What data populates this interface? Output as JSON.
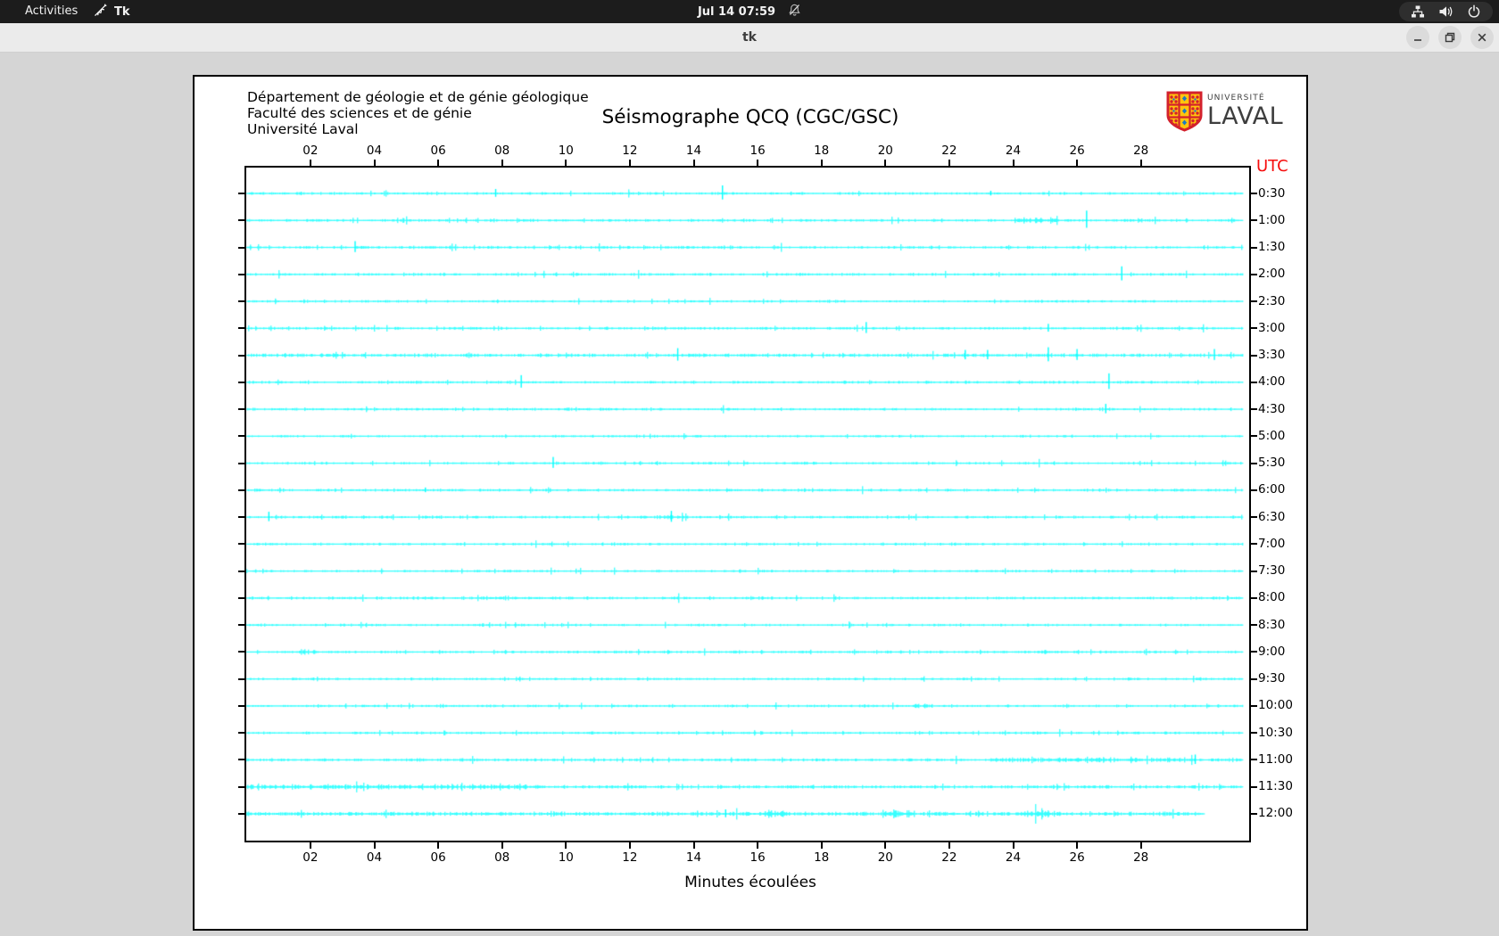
{
  "top_bar": {
    "activities": "Activities",
    "app_name": "Tk",
    "clock": "Jul 14 07:59",
    "bell_icon": "bell-muted",
    "status_icons": [
      "network",
      "volume",
      "power"
    ]
  },
  "window": {
    "title": "tk",
    "controls": [
      "minimize",
      "maximize",
      "close"
    ]
  },
  "document": {
    "org_lines": [
      "Département de géologie et de génie géologique",
      "Faculté des sciences et de génie",
      "Université Laval"
    ],
    "title": "Séismographe QCQ (CGC/GSC)",
    "logo": {
      "top": "UNIVERSITÉ",
      "bottom": "LAVAL"
    },
    "utc": "UTC",
    "utc_color": "#f60d0d",
    "xlabel": "Minutes écoulées"
  },
  "chart_data": {
    "type": "line",
    "title": "Séismographe QCQ (CGC/GSC)",
    "xlabel": "Minutes écoulées",
    "right_axis_title": "UTC",
    "x_range": [
      0,
      31.4
    ],
    "row_duration_min": 30,
    "x_axis_minutes": [
      2,
      4,
      6,
      8,
      10,
      12,
      14,
      16,
      18,
      20,
      22,
      24,
      26,
      28
    ],
    "x_tick_labels": [
      "02",
      "04",
      "06",
      "08",
      "10",
      "12",
      "14",
      "16",
      "18",
      "20",
      "22",
      "24",
      "26",
      "28"
    ],
    "trace_color": "#00ffff",
    "axis_color": "#000000",
    "background": "#ffffff",
    "rows": [
      {
        "label": "0:30",
        "base": 1.0,
        "spikes": [
          [
            7.8,
            5
          ],
          [
            14.9,
            9
          ],
          [
            23.3,
            3
          ]
        ],
        "bursts": []
      },
      {
        "label": "1:00",
        "base": 1.0,
        "spikes": [
          [
            26.3,
            11
          ]
        ],
        "bursts": [
          [
            24.0,
            25.4,
            2.4
          ]
        ]
      },
      {
        "label": "1:30",
        "base": 1.0,
        "spikes": [
          [
            3.4,
            7
          ]
        ],
        "bursts": []
      },
      {
        "label": "2:00",
        "base": 0.95,
        "spikes": [
          [
            27.4,
            9
          ]
        ],
        "bursts": []
      },
      {
        "label": "2:30",
        "base": 0.9,
        "spikes": [],
        "bursts": []
      },
      {
        "label": "3:00",
        "base": 1.0,
        "spikes": [
          [
            19.4,
            7
          ],
          [
            25.1,
            5
          ]
        ],
        "bursts": []
      },
      {
        "label": "3:30",
        "base": 1.3,
        "spikes": [
          [
            13.5,
            8
          ],
          [
            22.5,
            6
          ],
          [
            23.2,
            6
          ],
          [
            25.1,
            9
          ],
          [
            26.0,
            7
          ],
          [
            30.3,
            7
          ]
        ],
        "bursts": []
      },
      {
        "label": "4:00",
        "base": 1.0,
        "spikes": [
          [
            8.6,
            8
          ],
          [
            27.0,
            10
          ]
        ],
        "bursts": []
      },
      {
        "label": "4:30",
        "base": 0.95,
        "spikes": [
          [
            26.9,
            6
          ]
        ],
        "bursts": []
      },
      {
        "label": "5:00",
        "base": 0.85,
        "spikes": [],
        "bursts": []
      },
      {
        "label": "5:30",
        "base": 0.9,
        "spikes": [
          [
            9.6,
            7
          ]
        ],
        "bursts": []
      },
      {
        "label": "6:00",
        "base": 1.0,
        "spikes": [
          [
            5.6,
            3
          ]
        ],
        "bursts": []
      },
      {
        "label": "6:30",
        "base": 1.0,
        "spikes": [
          [
            0.7,
            6
          ],
          [
            13.3,
            7
          ]
        ],
        "bursts": [
          [
            12.9,
            13.7,
            2.0
          ]
        ]
      },
      {
        "label": "7:00",
        "base": 0.9,
        "spikes": [],
        "bursts": []
      },
      {
        "label": "7:30",
        "base": 0.9,
        "spikes": [],
        "bursts": []
      },
      {
        "label": "8:00",
        "base": 1.0,
        "spikes": [],
        "bursts": [
          [
            7.0,
            8.2,
            1.7
          ]
        ]
      },
      {
        "label": "8:30",
        "base": 0.9,
        "spikes": [],
        "bursts": []
      },
      {
        "label": "9:00",
        "base": 1.0,
        "spikes": [],
        "bursts": [
          [
            1.6,
            2.2,
            1.9
          ]
        ]
      },
      {
        "label": "9:30",
        "base": 0.9,
        "spikes": [],
        "bursts": []
      },
      {
        "label": "10:00",
        "base": 0.95,
        "spikes": [],
        "bursts": [
          [
            20.9,
            21.6,
            1.5
          ]
        ]
      },
      {
        "label": "10:30",
        "base": 0.95,
        "spikes": [],
        "bursts": []
      },
      {
        "label": "11:00",
        "base": 1.1,
        "spikes": [
          [
            29.7,
            6
          ]
        ],
        "bursts": [
          [
            23.3,
            29.6,
            1.6
          ]
        ]
      },
      {
        "label": "11:30",
        "base": 1.25,
        "spikes": [],
        "bursts": [
          [
            0.0,
            9.2,
            1.5
          ]
        ]
      },
      {
        "label": "12:00",
        "base": 1.5,
        "end": 30.0,
        "spikes": [
          [
            15.0,
            5
          ]
        ],
        "bursts": [
          [
            16.1,
            16.9,
            1.7
          ],
          [
            19.9,
            20.9,
            2.0
          ],
          [
            24.3,
            25.1,
            1.9
          ]
        ]
      }
    ]
  }
}
